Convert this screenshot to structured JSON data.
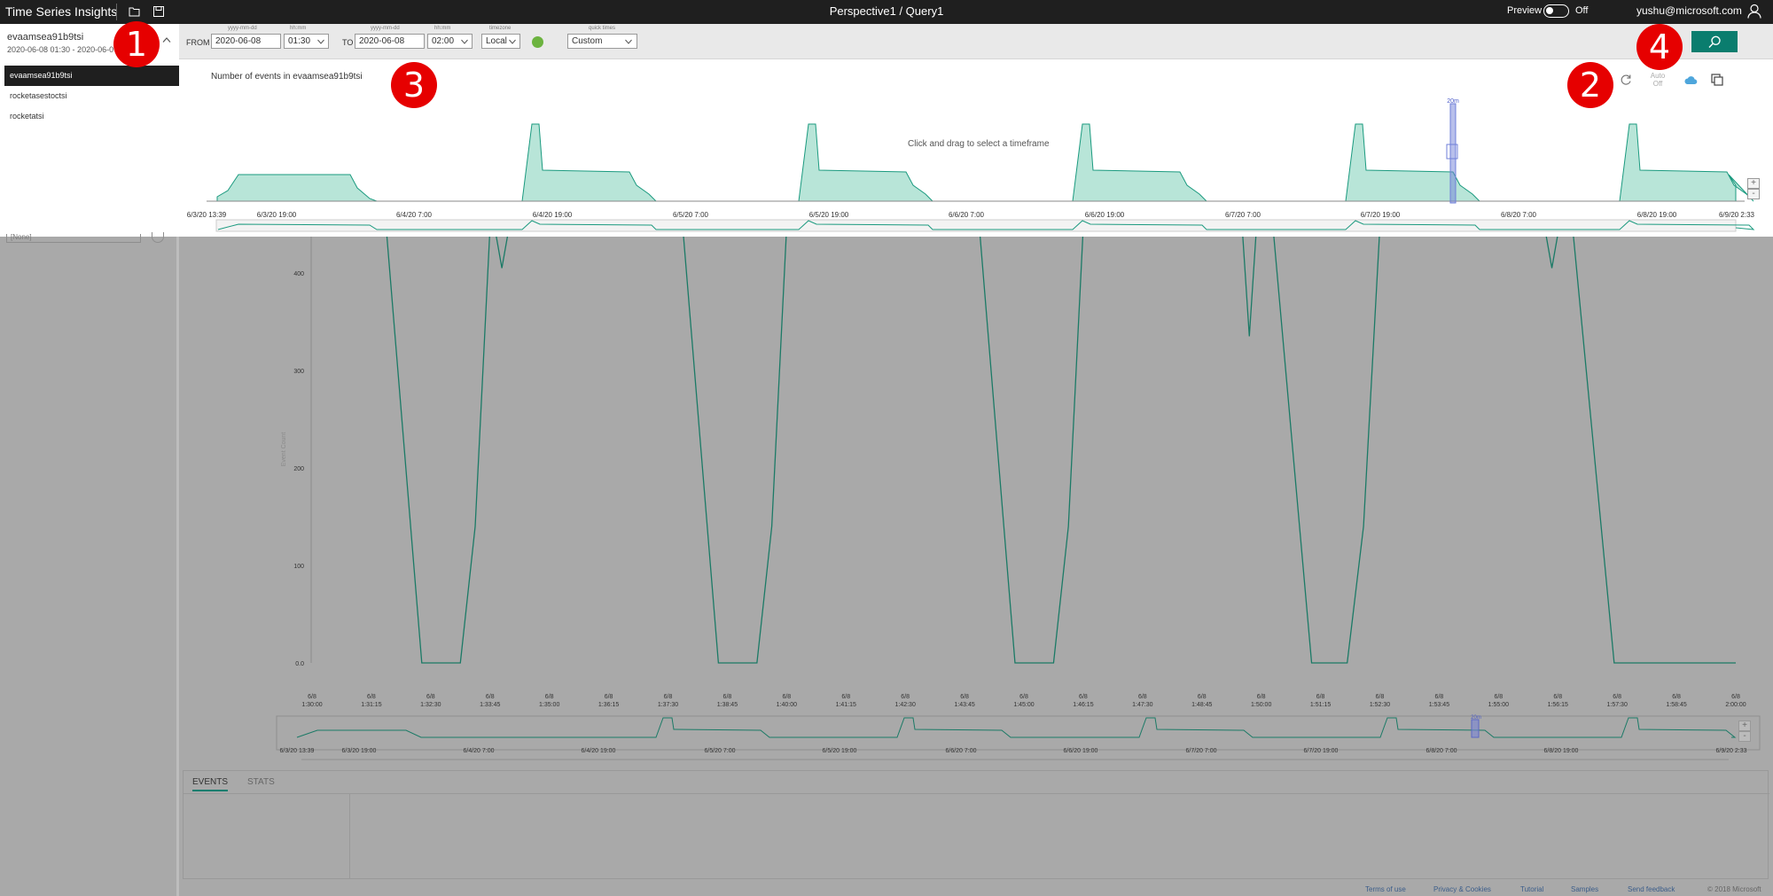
{
  "app": {
    "title": "Time Series Insights",
    "query_title": "Perspective1 / Query1",
    "preview_label": "Preview",
    "preview_state": "Off",
    "user_email": "yushu@microsoft.com"
  },
  "environment": {
    "selected_name": "evaamsea91b9tsi",
    "selected_range": "2020-06-08 01:30  -  2020-06-0",
    "items": [
      {
        "label": "evaamsea91b9tsi",
        "selected": true
      },
      {
        "label": "rocketasestoctsi",
        "selected": false
      },
      {
        "label": "rocketatsi",
        "selected": false
      }
    ]
  },
  "query": {
    "from_label": "FROM",
    "to_label": "TO",
    "date_hint": "yyyy-mm-dd",
    "time_hint": "hh:mm",
    "timezone_hint": "timezone",
    "quick_hint": "quick times",
    "from_date": "2020-06-08",
    "from_time": "01:30",
    "to_date": "2020-06-08",
    "to_time": "02:00",
    "timezone": "Local",
    "quick_time": "Custom"
  },
  "timeline": {
    "title": "Number of events in evaamsea91b9tsi",
    "hint": "Click and drag to select a timeframe",
    "auto_label": "Auto",
    "auto_state": "Off",
    "brush_label": "20m",
    "x_ticks": [
      "6/3/20 13:39",
      "6/3/20 19:00",
      "6/4/20 7:00",
      "6/4/20 19:00",
      "6/5/20 7:00",
      "6/5/20 19:00",
      "6/6/20 7:00",
      "6/6/20 19:00",
      "6/7/20 7:00",
      "6/7/20 19:00",
      "6/8/20 7:00",
      "6/8/20 19:00",
      "6/9/20 2:33"
    ]
  },
  "chart_data": [
    {
      "type": "area",
      "title": "Number of events in evaamsea91b9tsi",
      "x": [
        "6/3/20 13:39",
        "6/3/20 19:00",
        "6/4/20 7:00",
        "6/4/20 19:00",
        "6/5/20 7:00",
        "6/5/20 19:00",
        "6/6/20 7:00",
        "6/6/20 19:00",
        "6/7/20 7:00",
        "6/7/20 19:00",
        "6/8/20 7:00",
        "6/8/20 19:00",
        "6/9/20 2:33"
      ],
      "cycles": 6,
      "series_color": "#7ecfb8"
    },
    {
      "type": "line",
      "ylabel": "Event Count",
      "yticks": [
        "0.0",
        "100",
        "200",
        "300",
        "400"
      ],
      "ylim": [
        0,
        450
      ],
      "x_ticks": [
        "6/8 1:30:00",
        "6/8 1:31:15",
        "6/8 1:32:30",
        "6/8 1:33:45",
        "6/8 1:35:00",
        "6/8 1:36:15",
        "6/8 1:37:30",
        "6/8 1:38:45",
        "6/8 1:40:00",
        "6/8 1:41:15",
        "6/8 1:42:30",
        "6/8 1:43:45",
        "6/8 1:45:00",
        "6/8 1:46:15",
        "6/8 1:47:30",
        "6/8 1:48:45",
        "6/8 1:50:00",
        "6/8 1:51:15",
        "6/8 1:52:30",
        "6/8 1:53:45",
        "6/8 1:55:00",
        "6/8 1:56:15",
        "6/8 1:57:30",
        "6/8 1:58:45",
        "6/8 2:00:00"
      ],
      "series_color": "#1b7a66",
      "dips": [
        {
          "start": 1.25,
          "bottom_from": 1.85,
          "bottom_to": 2.5,
          "end": 3.0
        },
        {
          "start": 6.25,
          "bottom_from": 6.85,
          "bottom_to": 7.5,
          "end": 8.0
        },
        {
          "start": 11.25,
          "bottom_from": 11.85,
          "bottom_to": 12.5,
          "end": 13.0
        },
        {
          "start": 16.2,
          "bottom_from": 16.85,
          "bottom_to": 17.45,
          "end": 18.0
        },
        {
          "start": 21.25,
          "bottom_from": 21.95,
          "bottom_to": 22.85,
          "end": 22.85
        }
      ],
      "notches": [
        {
          "x": 3.2,
          "y": 405
        },
        {
          "x": 15.8,
          "y": 335
        },
        {
          "x": 20.9,
          "y": 405
        }
      ]
    }
  ],
  "mini_timeline": {
    "x_ticks": [
      "6/3/20 13:39",
      "6/3/20 19:00",
      "6/4/20 7:00",
      "6/4/20 19:00",
      "6/5/20 7:00",
      "6/5/20 19:00",
      "6/6/20 7:00",
      "6/6/20 19:00",
      "6/7/20 7:00",
      "6/7/20 19:00",
      "6/8/20 7:00",
      "6/8/20 19:00",
      "6/9/20 2:33"
    ],
    "brush_label": "20m"
  },
  "bottom_tabs": {
    "events": "EVENTS",
    "stats": "STATS"
  },
  "footer": {
    "links": [
      "Terms of use",
      "Privacy & Cookies",
      "Tutorial",
      "Samples",
      "Send feedback"
    ],
    "copyright": "© 2018 Microsoft"
  },
  "zoom": {
    "plus": "+",
    "minus": "-"
  },
  "left_ghost": {
    "text": "[None]"
  },
  "callouts": [
    "1",
    "2",
    "3",
    "4"
  ],
  "colors": {
    "accent": "#0a7d6e",
    "area": "#7ecfb8",
    "line": "#1b7a66",
    "callout": "#e60000",
    "ok": "#6cb33f"
  }
}
